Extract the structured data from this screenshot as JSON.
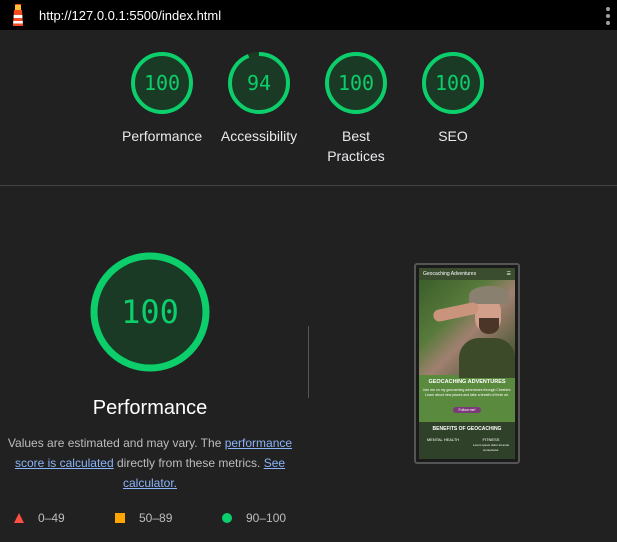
{
  "browser": {
    "url": "http://127.0.0.1:5500/index.html",
    "menu_icon": "vertical-dots-icon",
    "logo_icon": "lighthouse-icon"
  },
  "colors": {
    "pass": "#0cce6b",
    "pass_fill": "#1a3a26",
    "average": "#ffa400",
    "fail": "#ff4e42",
    "background": "#212121",
    "link": "#8ab4f8"
  },
  "gauges": [
    {
      "label": "Performance",
      "score": "100",
      "fraction": 1.0
    },
    {
      "label": "Accessibility",
      "score": "94",
      "fraction": 0.94
    },
    {
      "label": "Best Practices",
      "score": "100",
      "fraction": 1.0
    },
    {
      "label": "SEO",
      "score": "100",
      "fraction": 1.0
    }
  ],
  "main": {
    "score": "100",
    "fraction": 1.0,
    "title": "Performance",
    "desc_part1": "Values are estimated and may vary. The ",
    "link1": "performance score is calculated",
    "desc_part2": " directly from these metrics. ",
    "link2": "See calculator."
  },
  "legend": [
    {
      "icon": "triangle-icon",
      "range": "0–49"
    },
    {
      "icon": "square-icon",
      "range": "50–89"
    },
    {
      "icon": "circle-icon",
      "range": "90–100"
    }
  ],
  "preview": {
    "site_title": "Geocaching Adventures",
    "menu_icon": "hamburger-icon",
    "hero_heading": "GEOCACHING ADVENTURES",
    "hero_text": "Join me on my geocaching adventures through Cheshire. Learn about new places and take a breath of fresh air.",
    "hero_button": "Follow me!",
    "section_heading": "BENEFITS OF GEOCACHING",
    "benefit1": "MENTAL HEALTH",
    "benefit2": "FITNESS",
    "benefit2_text": "Lorem ipsum dolor sit amet consectetur."
  }
}
